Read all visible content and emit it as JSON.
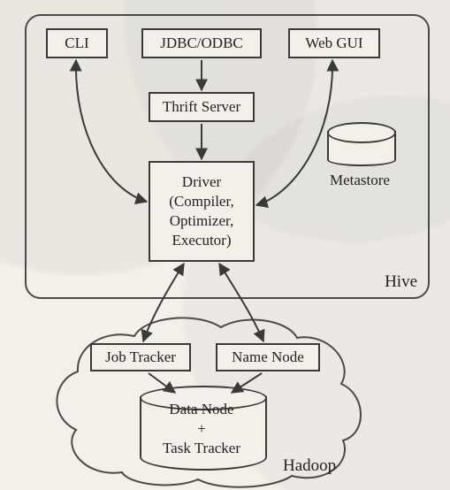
{
  "hive": {
    "label": "Hive",
    "cli": "CLI",
    "jdbc": "JDBC/ODBC",
    "webgui": "Web GUI",
    "thrift": "Thrift Server",
    "driver": {
      "l1": "Driver",
      "l2": "(Compiler,",
      "l3": "Optimizer,",
      "l4": "Executor)"
    },
    "metastore": "Metastore"
  },
  "hadoop": {
    "label": "Hadoop",
    "jobtracker": "Job Tracker",
    "namenode": "Name Node",
    "datanode": {
      "l1": "Data Node",
      "l2": "+",
      "l3": "Task Tracker"
    }
  }
}
